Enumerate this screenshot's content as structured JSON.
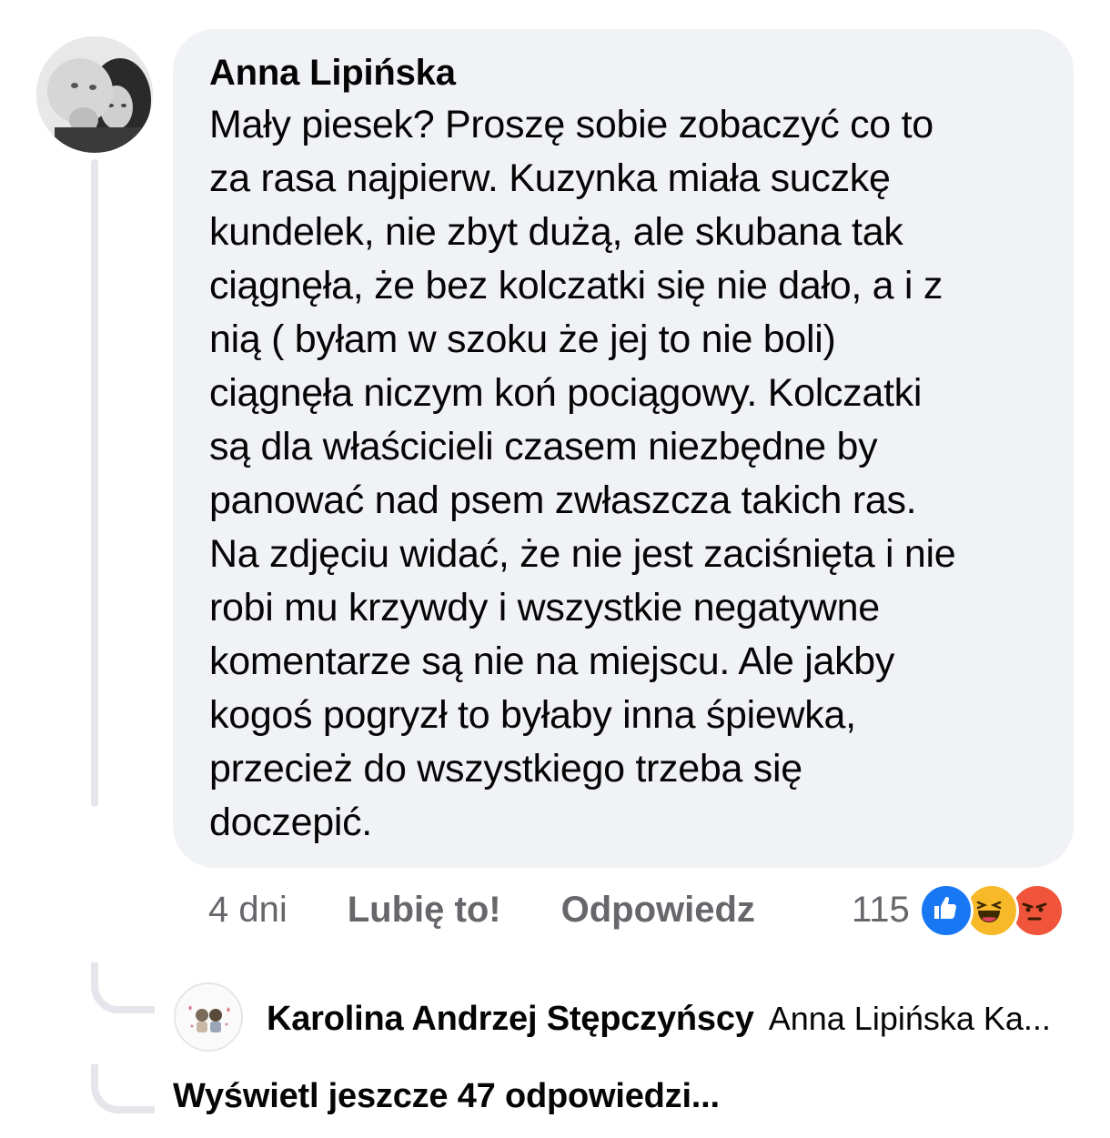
{
  "comment": {
    "author": "Anna Lipińska",
    "lines": [
      "Mały piesek? Proszę sobie zobaczyć co to",
      "za rasa najpierw. Kuzynka miała suczkę",
      "kundelek, nie zbyt dużą, ale skubana tak",
      "ciągnęła, że bez kolczatki się nie dało, a i z",
      "nią ( byłam w szoku że jej to nie boli)",
      "ciągnęła niczym koń pociągowy. Kolczatki",
      "są dla właścicieli czasem niezbędne by",
      "panować nad psem zwłaszcza takich ras.",
      "Na zdjęciu widać, że nie jest zaciśnięta i nie",
      "robi mu krzywdy i wszystkie negatywne",
      "komentarze są nie na miejscu. Ale jakby",
      "kogoś pogryzł to byłaby inna śpiewka,",
      "przecież do wszystkiego trzeba się",
      "doczepić."
    ],
    "time": "4 dni",
    "like_label": "Lubię to!",
    "reply_label": "Odpowiedz",
    "reaction_count": "115",
    "reactions": [
      "like-icon",
      "haha-icon",
      "angry-icon"
    ]
  },
  "reply": {
    "author": "Karolina Andrzej Stępczyńscy",
    "preview": "Anna Lipińska Ka..."
  },
  "more_replies_label": "Wyświetl jeszcze 47 odpowiedzi...",
  "colors": {
    "bubble": "#f0f2f5",
    "muted_text": "#65676b",
    "like_blue": "#1877f2",
    "haha_yellow": "#f7b928",
    "angry_red": "#f0543a"
  }
}
